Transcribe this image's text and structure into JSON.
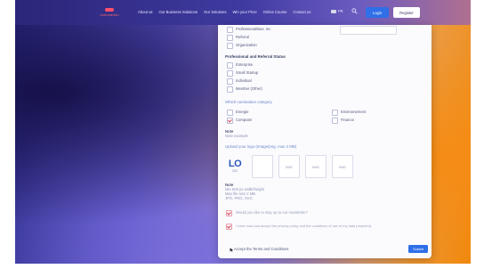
{
  "header": {
    "logo_word": "nomination",
    "nav": [
      "About us",
      "Our Business Solutions",
      "Our Solutions",
      "Win your Prize",
      "Online Course",
      "Contact us"
    ],
    "lang": "FR",
    "login_label": "Login",
    "register_label": "Register"
  },
  "form": {
    "top_items": [
      "Professional/Bus. Inc",
      "Referral",
      "Organization"
    ],
    "sector_title": "Professional and Referral Status",
    "sector_items": [
      "Enterprise",
      "Small Startup",
      "Individual",
      "Member (Other)"
    ],
    "company_section_title": "Which nomination category",
    "company_items_left": [
      "Energie",
      "Computer"
    ],
    "company_items_right": [
      "Environnement",
      "Finance"
    ],
    "note_label": "Note",
    "note_text": "Note example",
    "logo_section_title": "Upload your logo (Image/png, max 2 MB)",
    "logo_text": "LO",
    "logo_sub": "GO",
    "tile_labels": [
      "",
      "IMG",
      "IMG",
      "IMG"
    ],
    "rules_label": "Note",
    "rules_lines": [
      "Min 500 px width/height",
      "Max file size 2 MB",
      "JPG, PNG, SVG"
    ],
    "consent_1": "Would you like to stay up to our newsletter?",
    "consent_2": "I have read and accept the privacy policy and the conditions of use of my data (required).",
    "terms_label": "Accept the Terms and Conditions",
    "submit_label": "Submit"
  },
  "colors": {
    "accent": "#2f6fe8",
    "check": "#d6475d",
    "section_blue": "#6f86c8"
  }
}
